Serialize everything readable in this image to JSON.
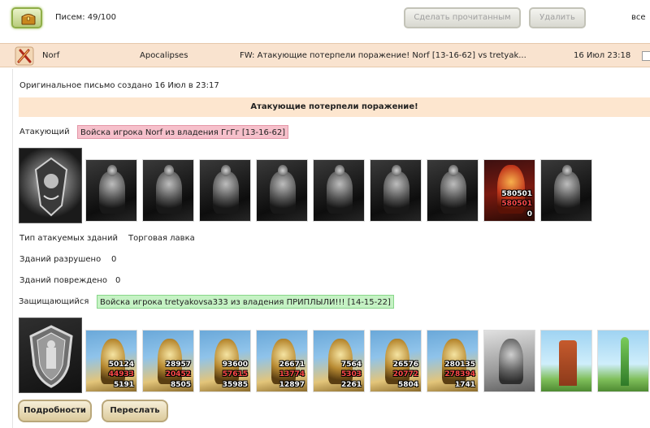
{
  "toolbar": {
    "letters_label": "Писем: 49/100",
    "mark_read_label": "Сделать прочитанным",
    "delete_label": "Удалить",
    "select_all_label": "все"
  },
  "message": {
    "from": "Norf",
    "to": "Apocalipses",
    "subject": "FW: Атакующие потерпели поражение! Norf [13-16-62] vs tretyak...",
    "date": "16 Июл 23:18"
  },
  "report": {
    "original_created": "Оригинальное письмо создано 16 Июл в 23:17",
    "banner": "Атакующие потерпели поражение!",
    "attacker_label": "Атакующий",
    "attacker_tag": "Войска игрока Norf из владения ГгГг [13-16-62]",
    "building_type_label": "Тип атакуемых зданий",
    "building_type_value": "Торговая лавка",
    "destroyed_label": "Зданий разрушено",
    "destroyed_value": "0",
    "damaged_label": "Зданий повреждено",
    "damaged_value": "0",
    "defender_label": "Защищающийся",
    "defender_tag": "Войска игрока tretyakovsa333 из владения ПРИПЛЫЛИ!!! [14-15-22]",
    "attacker_units": [
      {
        "style": "bw"
      },
      {
        "style": "bw"
      },
      {
        "style": "bw"
      },
      {
        "style": "bw"
      },
      {
        "style": "bw"
      },
      {
        "style": "bw"
      },
      {
        "style": "bw"
      },
      {
        "style": "demon",
        "n1": "580501",
        "n2": "580501",
        "n3": "0"
      },
      {
        "style": "bw"
      }
    ],
    "defender_units": [
      {
        "style": "color",
        "n1": "50124",
        "n2": "44933",
        "n3": "5191"
      },
      {
        "style": "color",
        "n1": "28957",
        "n2": "20452",
        "n3": "8505"
      },
      {
        "style": "color",
        "n1": "93600",
        "n2": "57615",
        "n3": "35985"
      },
      {
        "style": "color",
        "n1": "26671",
        "n2": "13774",
        "n3": "12897"
      },
      {
        "style": "color",
        "n1": "7564",
        "n2": "5303",
        "n3": "2261"
      },
      {
        "style": "color",
        "n1": "26576",
        "n2": "20772",
        "n3": "5804"
      },
      {
        "style": "color",
        "n1": "280135",
        "n2": "278394",
        "n3": "1741"
      },
      {
        "style": "gray"
      },
      {
        "style": "tower"
      },
      {
        "style": "tower2"
      }
    ]
  },
  "footer": {
    "details_label": "Подробности",
    "forward_label": "Переслать"
  }
}
